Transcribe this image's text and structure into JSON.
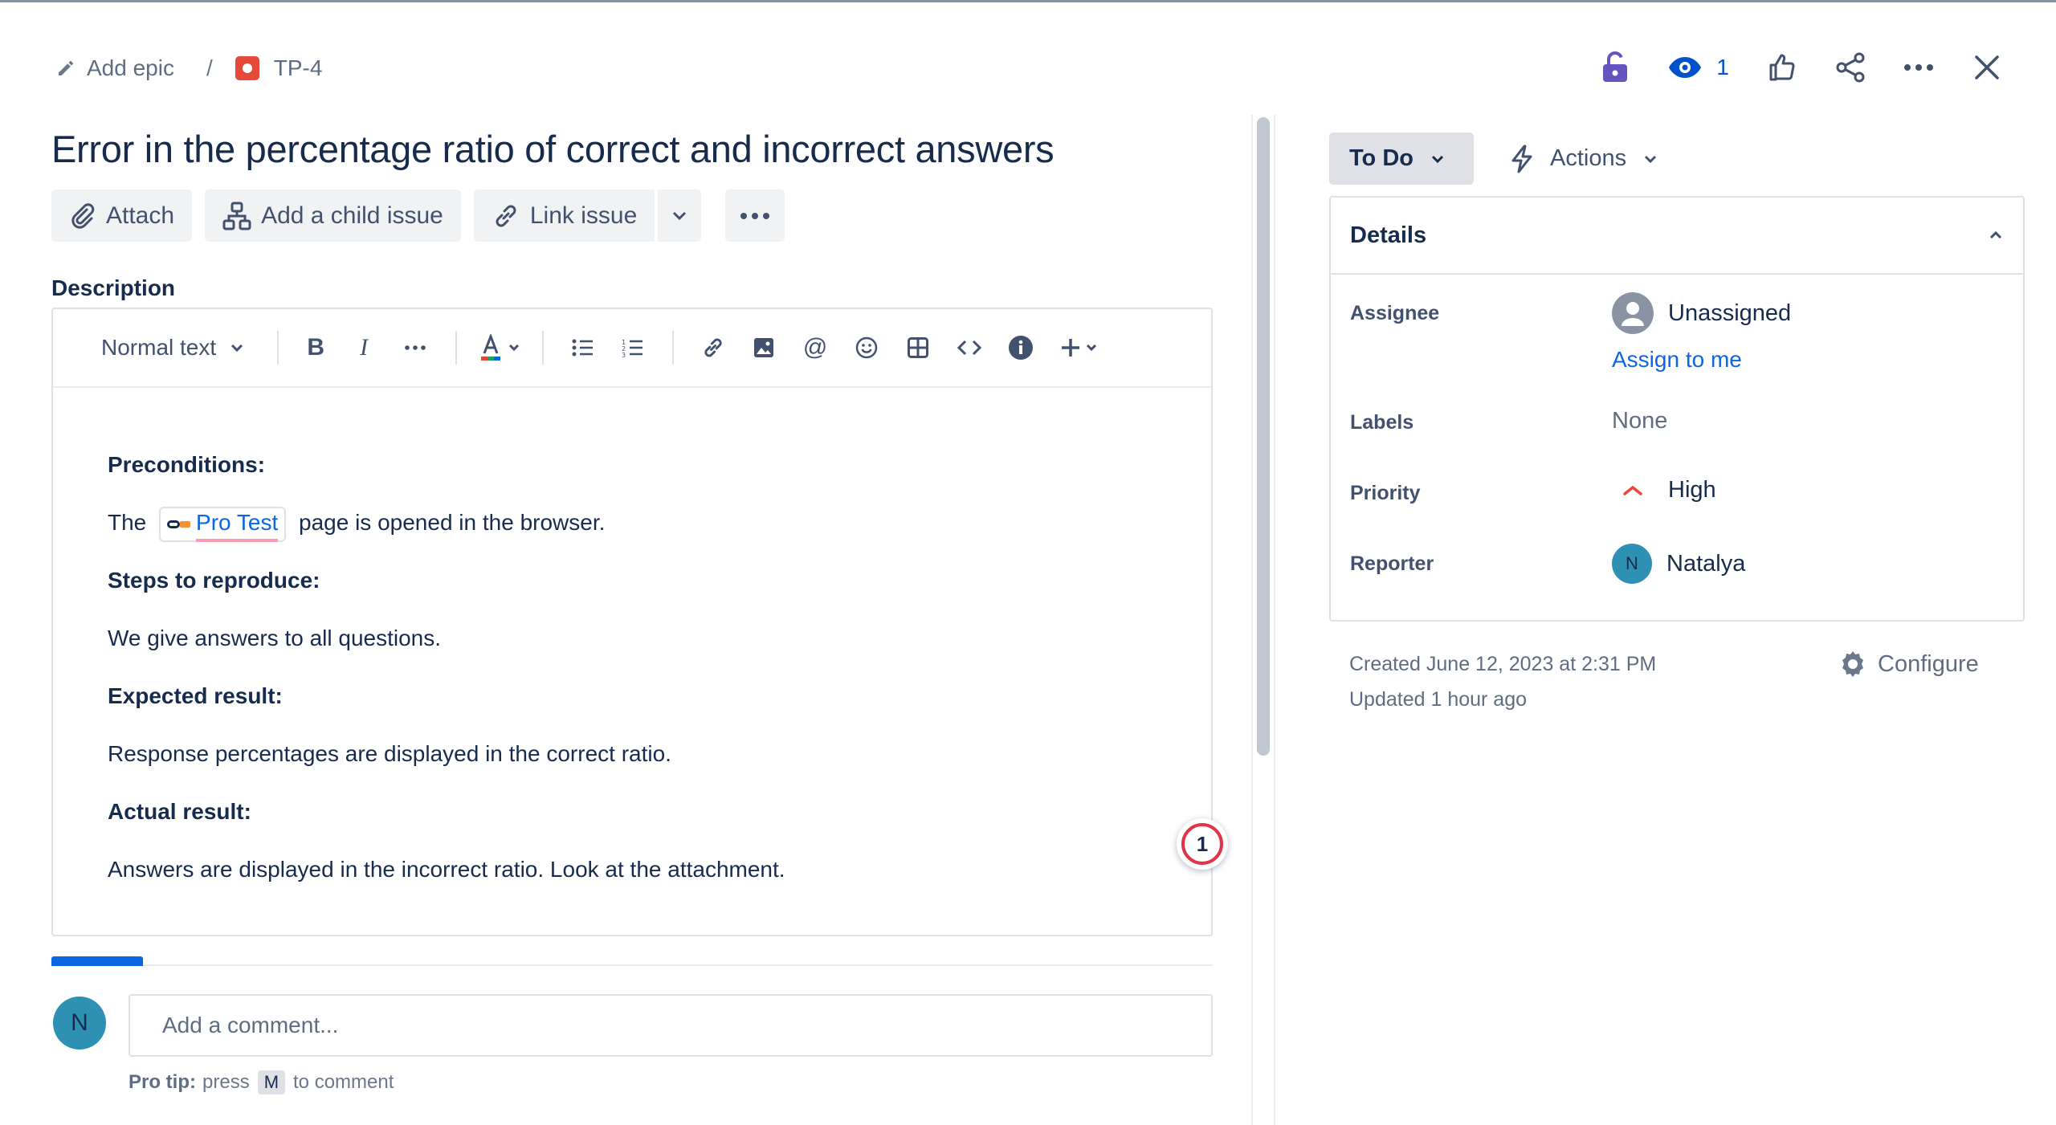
{
  "breadcrumb": {
    "add_epic": "Add epic",
    "separator": "/",
    "issue_key": "TP-4"
  },
  "top_actions": {
    "watch_count": "1"
  },
  "issue": {
    "title": "Error in the percentage ratio of correct and incorrect answers"
  },
  "action_buttons": {
    "attach": "Attach",
    "add_child": "Add a child issue",
    "link_issue": "Link issue"
  },
  "description": {
    "label": "Description",
    "toolbar": {
      "text_style": "Normal text"
    },
    "preconditions_heading": "Preconditions:",
    "precondition_prefix": "The",
    "chip_label": "Pro Test",
    "precondition_suffix": "page is opened in the browser.",
    "steps_heading": "Steps to reproduce:",
    "steps_text": "We give answers to all questions.",
    "expected_heading": "Expected result:",
    "expected_text": "Response percentages are displayed in the correct ratio.",
    "actual_heading": "Actual result:",
    "actual_text": "Answers are displayed in the incorrect ratio. Look at the attachment.",
    "badge_count": "1"
  },
  "comment": {
    "avatar_initial": "N",
    "placeholder": "Add a comment...",
    "protip_label": "Pro tip:",
    "protip_press": "press",
    "protip_key": "M",
    "protip_suffix": "to comment"
  },
  "sidebar": {
    "status": "To Do",
    "actions": "Actions",
    "details_title": "Details",
    "assignee_label": "Assignee",
    "assignee_value": "Unassigned",
    "assign_to_me": "Assign to me",
    "labels_label": "Labels",
    "labels_value": "None",
    "priority_label": "Priority",
    "priority_value": "High",
    "reporter_label": "Reporter",
    "reporter_initial": "N",
    "reporter_value": "Natalya",
    "created": "Created June 12, 2023 at 2:31 PM",
    "updated": "Updated 1 hour ago",
    "configure": "Configure"
  },
  "colors": {
    "accent": "#0c66e4",
    "issue_type": "#e5493a",
    "priority_high": "#e5493a",
    "watch_icon": "#0052cc",
    "lock_icon": "#6554c0"
  }
}
